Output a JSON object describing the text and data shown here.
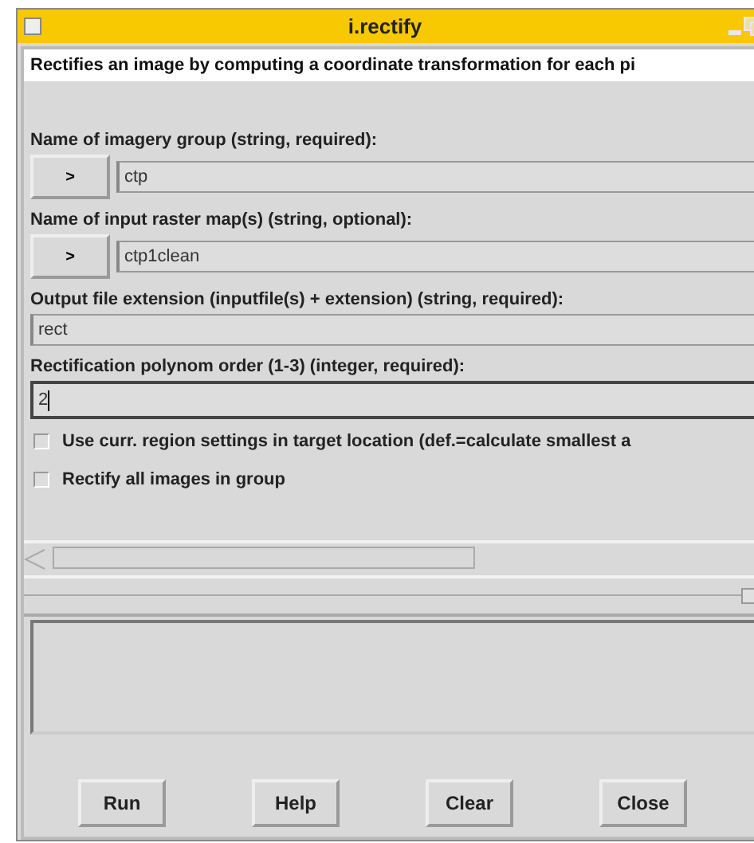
{
  "window": {
    "title": "i.rectify"
  },
  "description": "Rectifies an image by computing a coordinate transformation for each pi",
  "options": [
    {
      "kind": "select",
      "label": "Name of imagery group (string, required):",
      "button": ">",
      "value": "ctp",
      "focused": false
    },
    {
      "kind": "select",
      "label": "Name of input raster map(s) (string, optional):",
      "button": ">",
      "value": "ctp1clean",
      "focused": false
    },
    {
      "kind": "entry",
      "label": "Output file extension (inputfile(s) + extension) (string, required):",
      "value": "rect",
      "focused": false
    },
    {
      "kind": "entry",
      "label": "Rectification polynom order (1-3) (integer, required):",
      "value": "2",
      "focused": true
    },
    {
      "kind": "checkbox",
      "label": "Use curr. region settings in target location (def.=calculate smallest a",
      "checked": false
    },
    {
      "kind": "checkbox",
      "label": "Rectify all images in group",
      "checked": false
    }
  ],
  "buttons": [
    "Run",
    "Help",
    "Clear",
    "Close"
  ]
}
